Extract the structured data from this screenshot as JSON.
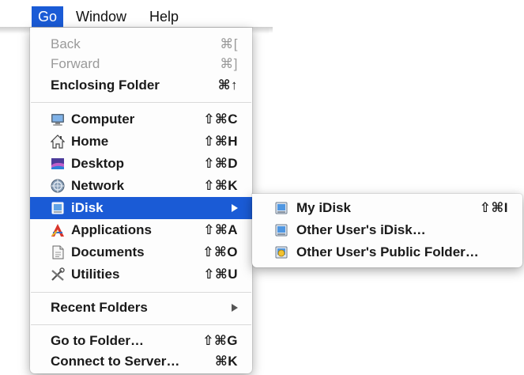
{
  "menubar": {
    "items": [
      {
        "label": "Go",
        "selected": true
      },
      {
        "label": "Window"
      },
      {
        "label": "Help"
      }
    ]
  },
  "go_menu": {
    "nav": [
      {
        "label": "Back",
        "shortcut": "⌘[",
        "disabled": true
      },
      {
        "label": "Forward",
        "shortcut": "⌘]",
        "disabled": true
      },
      {
        "label": "Enclosing Folder",
        "shortcut": "⌘↑"
      }
    ],
    "places": [
      {
        "label": "Computer",
        "shortcut": "⇧⌘C",
        "icon": "computer-icon"
      },
      {
        "label": "Home",
        "shortcut": "⇧⌘H",
        "icon": "home-icon"
      },
      {
        "label": "Desktop",
        "shortcut": "⇧⌘D",
        "icon": "desktop-icon"
      },
      {
        "label": "Network",
        "shortcut": "⇧⌘K",
        "icon": "network-icon"
      },
      {
        "label": "iDisk",
        "icon": "idisk-icon",
        "selected": true,
        "submenu": true
      },
      {
        "label": "Applications",
        "shortcut": "⇧⌘A",
        "icon": "applications-icon"
      },
      {
        "label": "Documents",
        "shortcut": "⇧⌘O",
        "icon": "documents-icon"
      },
      {
        "label": "Utilities",
        "shortcut": "⇧⌘U",
        "icon": "utilities-icon"
      }
    ],
    "recent": {
      "label": "Recent Folders"
    },
    "connect": [
      {
        "label": "Go to Folder…",
        "shortcut": "⇧⌘G"
      },
      {
        "label": "Connect to Server…",
        "shortcut": "⌘K"
      }
    ]
  },
  "idisk_submenu": {
    "items": [
      {
        "label": "My iDisk",
        "shortcut": "⇧⌘I",
        "icon": "idisk-icon"
      },
      {
        "label": "Other User's iDisk…",
        "icon": "idisk-icon"
      },
      {
        "label": "Other User's Public Folder…",
        "icon": "public-folder-icon"
      }
    ]
  },
  "colors": {
    "selection": "#1a5bd6",
    "disabled_text": "#9a9a9a"
  }
}
